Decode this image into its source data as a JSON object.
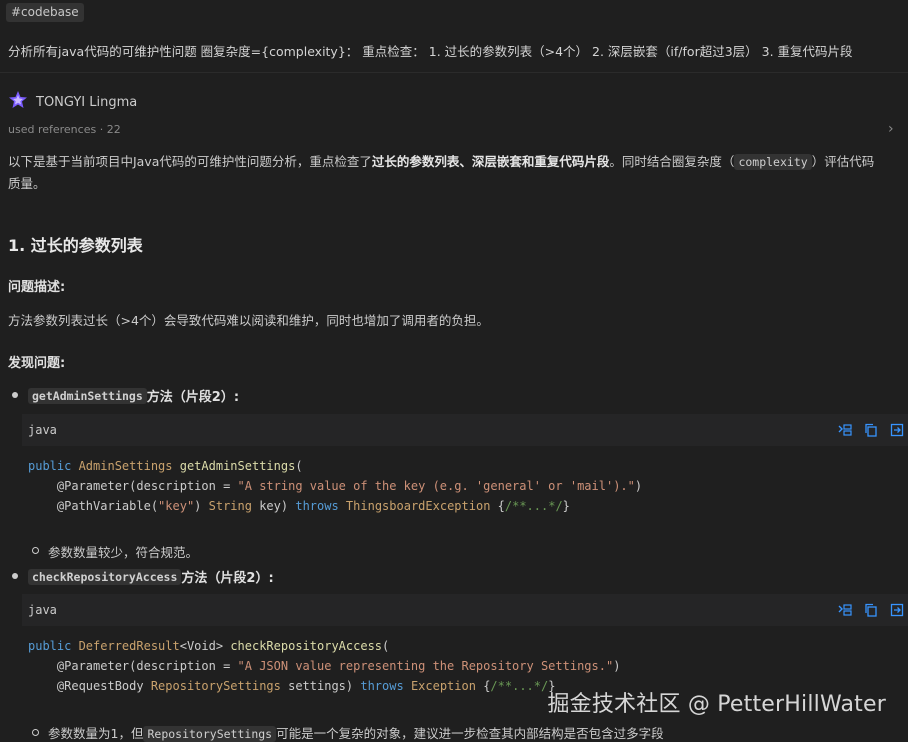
{
  "context_tag": "#codebase",
  "prompt": "分析所有java代码的可维护性问题 圈复杂度={complexity}： 重点检查： 1. 过长的参数列表（>4个） 2. 深层嵌套（if/for超过3层） 3. 重复代码片段",
  "assistant": {
    "name": "TONGYI Lingma",
    "references": "used references · 22"
  },
  "intro": {
    "part1": "以下是基于当前项目中Java代码的可维护性问题分析，重点检查了",
    "bold": "过长的参数列表、深层嵌套和重复代码片段",
    "part2": "。同时结合圈复杂度（",
    "code": "complexity",
    "part3": "）评估代码",
    "line2": "质量。"
  },
  "section1": {
    "title": "1. 过长的参数列表",
    "problem_heading": "问题描述:",
    "problem_text": "方法参数列表过长（>4个）会导致代码难以阅读和维护，同时也增加了调用者的负担。",
    "found_heading": "发现问题:",
    "items": [
      {
        "method": "getAdminSettings",
        "suffix": " 方法（片段2）:",
        "lang": "java",
        "code": {
          "l1_kw": "public ",
          "l1_ty": "AdminSettings ",
          "l1_fn": "getAdminSettings",
          "l1_rest": "(",
          "l2_an": "    @Parameter(description = ",
          "l2_str": "\"A string value of the key (e.g. 'general' or 'mail').\"",
          "l2_rest": ")",
          "l3_an": "    @PathVariable(",
          "l3_str": "\"key\"",
          "l3_mid": ") ",
          "l3_ty": "String",
          "l3_mid2": " key) ",
          "l3_kw": "throws ",
          "l3_ty2": "ThingsboardException",
          "l3_rest": " {",
          "l3_cm": "/**...*/",
          "l3_end": "}"
        },
        "note": "参数数量较少，符合规范。"
      },
      {
        "method": "checkRepositoryAccess",
        "suffix": " 方法（片段2）:",
        "lang": "java",
        "code": {
          "l1_kw": "public ",
          "l1_ty": "DeferredResult",
          "l1_gen": "<Void> ",
          "l1_fn": "checkRepositoryAccess",
          "l1_rest": "(",
          "l2_an": "    @Parameter(description = ",
          "l2_str": "\"A JSON value representing the Repository Settings.\"",
          "l2_rest": ")",
          "l3_an": "    @RequestBody ",
          "l3_ty": "RepositorySettings",
          "l3_mid": " settings) ",
          "l3_kw": "throws ",
          "l3_ty2": "Exception",
          "l3_rest": " {",
          "l3_cm": "/**...*/",
          "l3_end": "}"
        },
        "note_start": "参数数量为1，但",
        "note_code": "RepositorySettings",
        "note_end": "可能是一个复杂的对象，建议进一步检查其内部结构是否包含过多字段"
      }
    ]
  },
  "code_tools": [
    "insert-icon",
    "copy-icon",
    "new-file-icon"
  ],
  "watermark": "掘金技术社区 @ PetterHillWater",
  "colors": {
    "background": "#1f1f1f",
    "code_header": "#252526",
    "accent_icon": "#3794ff",
    "keyword": "#569cd6",
    "type": "#c9a26d",
    "function": "#dcdcaa",
    "string": "#ce9178"
  }
}
